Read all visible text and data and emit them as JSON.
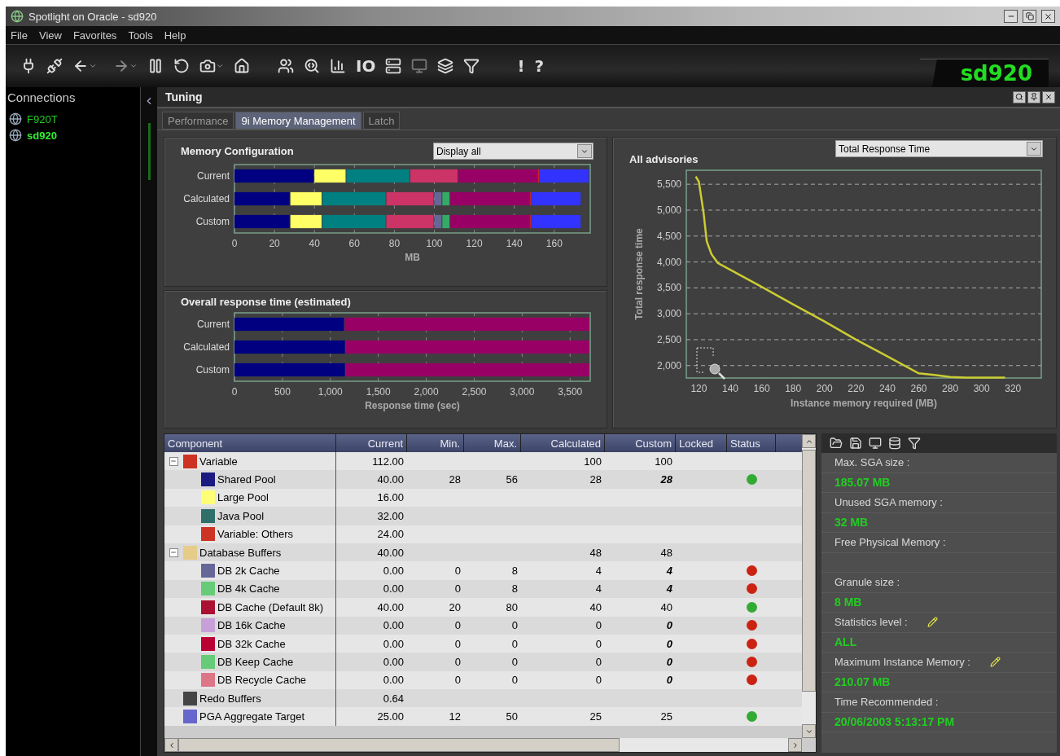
{
  "window": {
    "title": "Spotlight on Oracle - sd920"
  },
  "menu": [
    "File",
    "View",
    "Favorites",
    "Tools",
    "Help"
  ],
  "toolbar": {
    "io_label": "IO",
    "alert_label": "!",
    "help_label": "?",
    "badge": "sd920"
  },
  "sidebar": {
    "title": "Connections",
    "items": [
      {
        "label": "F920T",
        "selected": false
      },
      {
        "label": "sd920",
        "selected": true
      }
    ]
  },
  "panel": {
    "title": "Tuning"
  },
  "tabs": [
    {
      "label": "Performance",
      "selected": false
    },
    {
      "label": "9i Memory Management",
      "selected": true
    },
    {
      "label": "Latch",
      "selected": false
    }
  ],
  "memory_configuration": {
    "title": "Memory Configuration",
    "dropdown": "Display all",
    "chart_data": {
      "type": "bar",
      "orientation": "horizontal",
      "stacked": true,
      "grid": true,
      "xlabel": "MB",
      "categories": [
        "Current",
        "Calculated",
        "Custom"
      ],
      "xlim": [
        0,
        178
      ],
      "xticks": [
        0,
        20,
        40,
        60,
        80,
        100,
        120,
        140,
        160
      ],
      "series": [
        {
          "color": "#000080",
          "values": [
            40,
            28,
            28
          ]
        },
        {
          "color": "#ffff66",
          "values": [
            16,
            16,
            16
          ]
        },
        {
          "color": "#008080",
          "values": [
            32,
            32,
            32
          ]
        },
        {
          "color": "#cc3366",
          "values": [
            24,
            24,
            24
          ]
        },
        {
          "color": "#666699",
          "values": [
            0,
            4,
            4
          ]
        },
        {
          "color": "#33aa66",
          "values": [
            0,
            4,
            4
          ]
        },
        {
          "color": "#990066",
          "values": [
            40,
            40,
            40
          ]
        },
        {
          "color": "#ee2222",
          "values": [
            0.6,
            0.6,
            0.6
          ]
        },
        {
          "color": "#3333ff",
          "values": [
            25,
            25,
            25
          ]
        }
      ]
    }
  },
  "response_time": {
    "title": "Overall response time (estimated)",
    "chart_data": {
      "type": "bar",
      "orientation": "horizontal",
      "stacked": true,
      "grid": true,
      "xlabel": "Response time (sec)",
      "categories": [
        "Current",
        "Calculated",
        "Custom"
      ],
      "xlim": [
        0,
        3710
      ],
      "xticks": [
        0,
        500,
        {
          "value": 1000,
          "label": "1,000"
        },
        {
          "value": 1500,
          "label": "1,500"
        },
        {
          "value": 2000,
          "label": "2,000"
        },
        {
          "value": 2500,
          "label": "2,500"
        },
        {
          "value": 3000,
          "label": "3,000"
        },
        {
          "value": 3500,
          "label": "3,500"
        }
      ],
      "series": [
        {
          "color": "#000080",
          "values": [
            1150,
            1160,
            1160
          ]
        },
        {
          "color": "#990066",
          "values": [
            2560,
            2550,
            2550
          ]
        }
      ]
    }
  },
  "advisories": {
    "title": "All advisories",
    "dropdown": "Total Response Time",
    "chart_data": {
      "type": "line",
      "grid": true,
      "xlabel": "Instance memory required (MB)",
      "ylabel": "Total response time",
      "xlim": [
        112,
        338
      ],
      "ylim": [
        1760,
        5770
      ],
      "xticks": [
        120,
        140,
        160,
        180,
        200,
        220,
        240,
        260,
        280,
        300,
        320
      ],
      "yticks": [
        {
          "value": 2000,
          "label": "2,000"
        },
        {
          "value": 2500,
          "label": "2,500"
        },
        {
          "value": 3000,
          "label": "3,000"
        },
        {
          "value": 3500,
          "label": "3,500"
        },
        {
          "value": 4000,
          "label": "4,000"
        },
        {
          "value": 4500,
          "label": "4,500"
        },
        {
          "value": 5000,
          "label": "5,000"
        },
        {
          "value": 5500,
          "label": "5,500"
        }
      ],
      "x": [
        118,
        120,
        123,
        125,
        128,
        132,
        140,
        160,
        180,
        200,
        220,
        240,
        260,
        270,
        280,
        290,
        300,
        315
      ],
      "series": [
        {
          "color": "#cccc33",
          "values": [
            5650,
            5550,
            4950,
            4400,
            4150,
            3980,
            3850,
            3520,
            3180,
            2850,
            2500,
            2180,
            1850,
            1820,
            1780,
            1770,
            1770,
            1770
          ]
        }
      ]
    }
  },
  "table": {
    "columns": [
      "Component",
      "Current",
      "Min.",
      "Max.",
      "Calculated",
      "Custom",
      "Locked",
      "Status"
    ],
    "rows": [
      {
        "component": "Variable",
        "color": "#cc3322",
        "expanded": true,
        "current": "112.00",
        "calculated": "100",
        "custom": "100",
        "custom_edited": false,
        "children": [
          {
            "component": "Shared Pool",
            "color": "#1a1a80",
            "current": "40.00",
            "min": "28",
            "max": "56",
            "calculated": "28",
            "custom": "28",
            "custom_edited": true,
            "status": {
              "color": "#33aa33"
            }
          },
          {
            "component": "Large Pool",
            "color": "#ffff77",
            "current": "16.00"
          },
          {
            "component": "Java Pool",
            "color": "#2f6f6a",
            "current": "32.00"
          },
          {
            "component": "Variable: Others",
            "color": "#cc3322",
            "current": "24.00"
          }
        ]
      },
      {
        "component": "Database Buffers",
        "color": "#e6cc88",
        "expanded": true,
        "current": "40.00",
        "calculated": "48",
        "custom": "48",
        "custom_edited": false,
        "children": [
          {
            "component": "DB 2k Cache",
            "color": "#666699",
            "current": "0.00",
            "min": "0",
            "max": "8",
            "calculated": "4",
            "custom": "4",
            "custom_edited": true,
            "status": {
              "color": "#cc2211"
            }
          },
          {
            "component": "DB 4k Cache",
            "color": "#66cc77",
            "current": "0.00",
            "min": "0",
            "max": "8",
            "calculated": "4",
            "custom": "4",
            "custom_edited": true,
            "status": {
              "color": "#cc2211"
            }
          },
          {
            "component": "DB Cache (Default 8k)",
            "color": "#aa1133",
            "current": "40.00",
            "min": "20",
            "max": "80",
            "calculated": "40",
            "custom": "40",
            "custom_edited": false,
            "status": {
              "color": "#33aa33"
            }
          },
          {
            "component": "DB 16k Cache",
            "color": "#c8a0d8",
            "current": "0.00",
            "min": "0",
            "max": "0",
            "calculated": "0",
            "custom": "0",
            "custom_edited": true,
            "status": {
              "color": "#cc2211"
            }
          },
          {
            "component": "DB 32k Cache",
            "color": "#bb0033",
            "current": "0.00",
            "min": "0",
            "max": "0",
            "calculated": "0",
            "custom": "0",
            "custom_edited": true,
            "status": {
              "color": "#cc2211"
            }
          },
          {
            "component": "DB Keep Cache",
            "color": "#66cc77",
            "current": "0.00",
            "min": "0",
            "max": "0",
            "calculated": "0",
            "custom": "0",
            "custom_edited": true,
            "status": {
              "color": "#cc2211"
            }
          },
          {
            "component": "DB Recycle Cache",
            "color": "#dd7788",
            "current": "0.00",
            "min": "0",
            "max": "0",
            "calculated": "0",
            "custom": "0",
            "custom_edited": true,
            "status": {
              "color": "#cc2211"
            }
          }
        ]
      },
      {
        "component": "Redo Buffers",
        "color": "#444444",
        "current": "0.64"
      },
      {
        "component": "PGA Aggregate Target",
        "color": "#6666cc",
        "current": "25.00",
        "min": "12",
        "max": "50",
        "calculated": "25",
        "custom": "25",
        "custom_edited": false,
        "status": {
          "color": "#33aa33"
        }
      }
    ]
  },
  "info": {
    "items": [
      {
        "label": "Max. SGA size :",
        "value": "185.07 MB",
        "editable": false
      },
      {
        "label": "Unused SGA memory :",
        "value": "32 MB",
        "editable": false
      },
      {
        "label": "Free Physical Memory :",
        "editable": false
      },
      {
        "label": "Granule size :",
        "value": "8 MB",
        "editable": false
      },
      {
        "label": "Statistics level :",
        "value": "ALL",
        "editable": true
      },
      {
        "label": "Maximum Instance Memory :",
        "value": "210.07 MB",
        "editable": true
      },
      {
        "label": "Time Recommended :",
        "value": "20/06/2003 5:13:17 PM",
        "editable": false
      }
    ]
  }
}
